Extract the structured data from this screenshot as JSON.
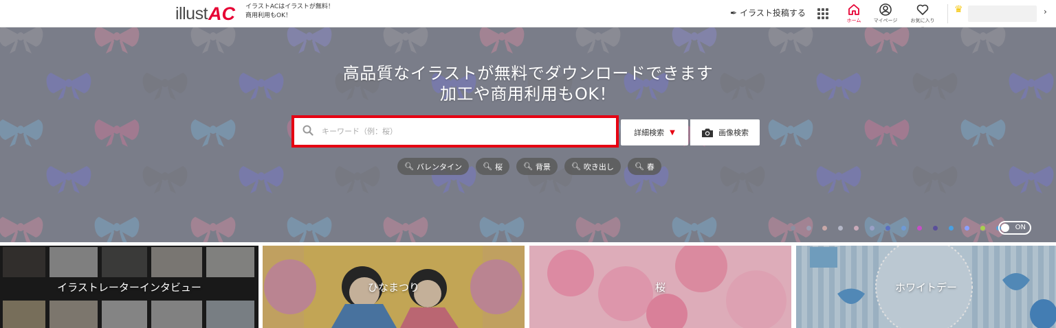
{
  "header": {
    "logo_main": "illust",
    "logo_accent": "AC",
    "tagline_line1": "イラストACはイラストが無料！",
    "tagline_line2": "商用利用もOK！",
    "post_link": "イラスト投稿する",
    "nav": {
      "home": "ホーム",
      "mypage": "マイページ",
      "favorites": "お気に入り ⌄"
    }
  },
  "hero": {
    "title_line1": "高品質なイラストが無料でダウンロードできます",
    "title_line2": "加工や商用利用もOK！",
    "search_placeholder": "キーワード（例：桜）",
    "advanced_search": "詳細検索",
    "image_search": "画像検索",
    "tags": [
      "バレンタイン",
      "桜",
      "背景",
      "吹き出し",
      "春"
    ],
    "toggle_label": "ON",
    "color_dots": [
      "#8d8fa0",
      "#9a9db2",
      "#c8a7a7",
      "#b3b6c6",
      "#c9a9b8",
      "#9aa0c6",
      "#5b6fc1",
      "#6f9ad6",
      "#c64fc6",
      "#5a4f9a",
      "#4aa0e0",
      "#8aa0ff",
      "#a7d04f",
      "#5aa0d6"
    ]
  },
  "features": [
    {
      "label": "イラストレーターインタビュー"
    },
    {
      "label": "ひなまつり"
    },
    {
      "label": "桜"
    },
    {
      "label": "ホワイトデー"
    }
  ]
}
